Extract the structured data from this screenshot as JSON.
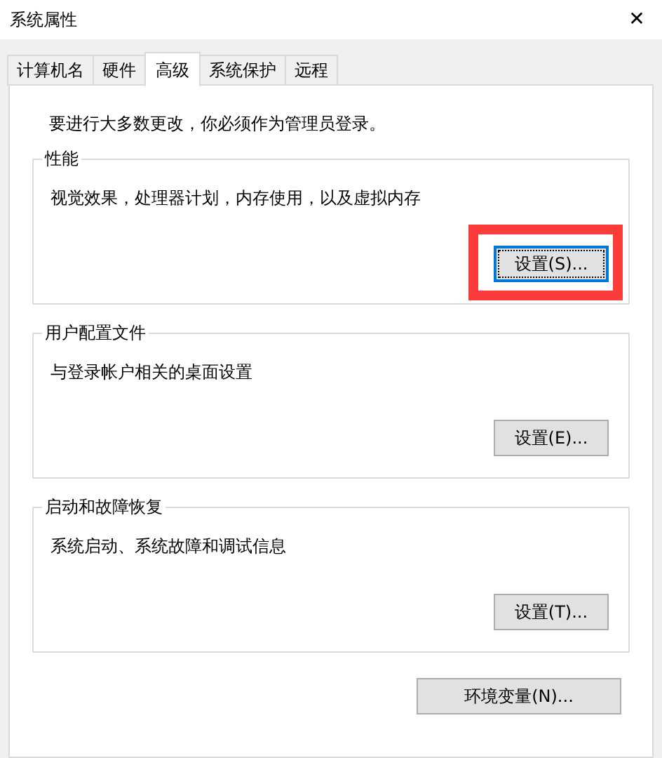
{
  "window": {
    "title": "系统属性",
    "close": "✕"
  },
  "tabs": [
    {
      "label": "计算机名",
      "selected": false
    },
    {
      "label": "硬件",
      "selected": false
    },
    {
      "label": "高级",
      "selected": true
    },
    {
      "label": "系统保护",
      "selected": false
    },
    {
      "label": "远程",
      "selected": false
    }
  ],
  "notice": "要进行大多数更改，你必须作为管理员登录。",
  "groups": [
    {
      "title": "性能",
      "description": "视觉效果，处理器计划，内存使用，以及虚拟内存",
      "button": {
        "label": "设置(S)...",
        "focused": true,
        "highlighted": true
      }
    },
    {
      "title": "用户配置文件",
      "description": "与登录帐户相关的桌面设置",
      "button": {
        "label": "设置(E)...",
        "focused": false,
        "highlighted": false
      }
    },
    {
      "title": "启动和故障恢复",
      "description": "系统启动、系统故障和调试信息",
      "button": {
        "label": "设置(T)...",
        "focused": false,
        "highlighted": false
      }
    }
  ],
  "env_button": {
    "label": "环境变量(N)..."
  }
}
